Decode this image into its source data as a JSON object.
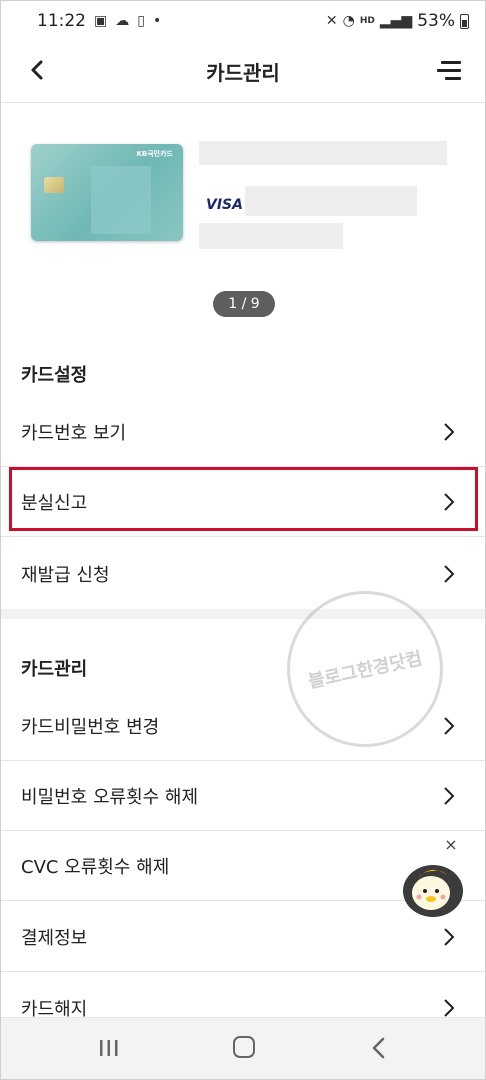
{
  "status_bar": {
    "time": "11:22",
    "dot": "•",
    "network_label": "HD",
    "battery": "53%"
  },
  "header": {
    "title": "카드관리"
  },
  "card": {
    "brand": "KB국민카드",
    "network": "VISA",
    "pager": "1 / 9"
  },
  "sections": [
    {
      "title": "카드설정",
      "items": [
        "카드번호 보기",
        "분실신고",
        "재발급 신청"
      ]
    },
    {
      "title": "카드관리",
      "items": [
        "카드비밀번호 변경",
        "비밀번호 오류횟수 해제",
        "CVC 오류횟수 해제",
        "결제정보",
        "카드해지"
      ]
    }
  ],
  "watermark": "블로그한경닷컴",
  "floating": {
    "close": "×"
  },
  "colors": {
    "highlight": "#c8102e",
    "pager_bg": "#5e5e5e"
  }
}
